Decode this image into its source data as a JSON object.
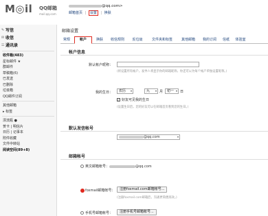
{
  "logo": {
    "text": "M◎il",
    "cn": "QQ邮箱",
    "url": "mail.qq.com"
  },
  "user_line": {
    "suffix": "@qq.com>"
  },
  "top_links": [
    "邮箱首页",
    "|",
    "设置",
    "|",
    "换肤"
  ],
  "sidebar": {
    "main": [
      {
        "icon": "pencil-icon",
        "glyph": "✎",
        "label": "写信"
      },
      {
        "icon": "inbox-icon",
        "glyph": "✉",
        "label": "收信"
      },
      {
        "icon": "contacts-icon",
        "glyph": "☷",
        "label": "通讯录"
      }
    ],
    "items": [
      {
        "label": "收件箱(483)",
        "bold": true
      },
      {
        "label": "星标邮件 ★",
        "bold": false
      },
      {
        "label": "群邮件",
        "bold": false
      },
      {
        "label": "草稿箱(6)",
        "bold": false
      },
      {
        "label": "已发送",
        "bold": false
      },
      {
        "label": "已删除",
        "bold": false
      },
      {
        "label": "垃圾箱",
        "bold": false
      },
      {
        "label": "QQ邮件订阅",
        "bold": false
      }
    ],
    "items2": [
      {
        "label": "其他邮箱"
      },
      {
        "label": "▸ 标签"
      }
    ],
    "items3": [
      {
        "label": "漂流瓶 ●"
      },
      {
        "label": "贺卡  |  明信片"
      },
      {
        "label": "日历  |  记事本"
      },
      {
        "label": "附件收藏"
      },
      {
        "label": "文件中转站"
      },
      {
        "label": "阅读空间(89+8)",
        "bold": true
      }
    ]
  },
  "content": {
    "title": "邮箱设置",
    "tabs": [
      "常规",
      "帐户",
      "换肤",
      "收信规则",
      "反垃圾",
      "文件夹和标签",
      "其他邮箱",
      "我的订阅",
      "信纸",
      "体验室"
    ],
    "active_tab": "帐户",
    "section_profile": {
      "title": "帐户信息",
      "nickname_label": "默认帐户昵称：",
      "nickname_hint": "(将设置所有帐户，发件人将显示你的邮箱昵称，你还可以为每个帐户单独设置昵称。)",
      "birthday_label": "我的生日：",
      "calendar": "农历",
      "month": "九",
      "month_unit": "月",
      "day": "初一",
      "day_unit": "日",
      "remind_label": "好友可见我的生日",
      "remind_hint": "(设置生日后，您的好友可以在邮箱首页看到您的生日。)"
    },
    "section_sender": {
      "title": "默认发信帐号",
      "account_suffix": "@qq.com"
    },
    "section_accounts": {
      "title": "邮箱帐号",
      "english_label": "英文邮箱帐号：",
      "english_suffix": "@qq.com",
      "foxmail_label": "foxmail邮箱帐号：",
      "foxmail_button": "注册foxmail.com邮箱帐号...",
      "foxmail_hint": "(注册foxmail.com邮箱后，沟通更简便高效。)",
      "mobile_label": "手机号邮箱帐号：",
      "mobile_button": "注册手机号邮箱帐号..."
    }
  },
  "colors": {
    "highlight": "#e0291f",
    "link": "#23487f",
    "sidebar_bg": "#f6f6f6"
  }
}
